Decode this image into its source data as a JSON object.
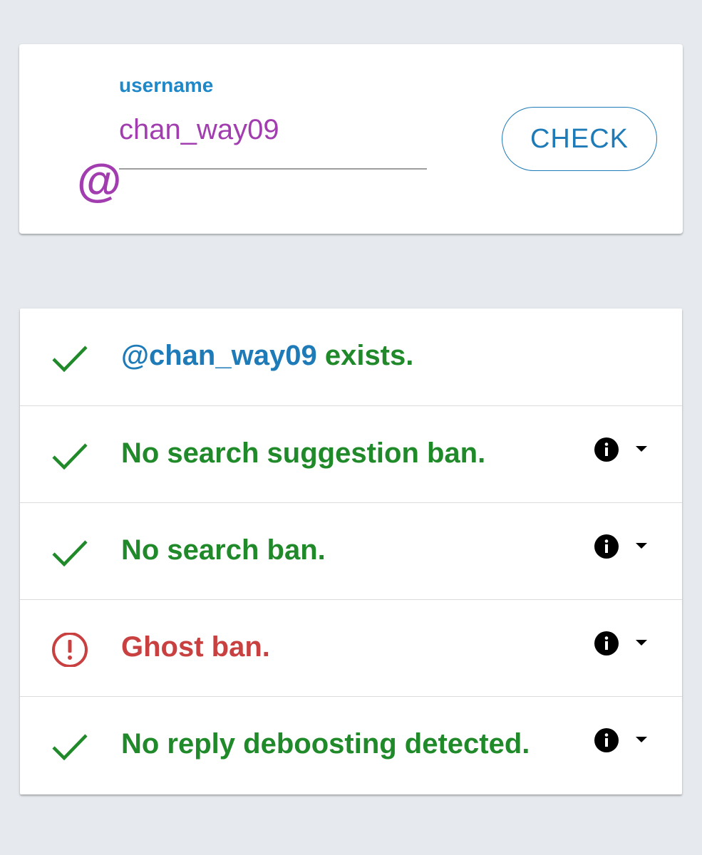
{
  "input_card": {
    "at_symbol": "@",
    "label": "username",
    "value": "chan_way09",
    "check_label": "CHECK"
  },
  "results": [
    {
      "status": "ok",
      "icon": "checkmark-icon",
      "handle": "@chan_way09",
      "text": " exists.",
      "has_info": false
    },
    {
      "status": "ok",
      "icon": "checkmark-icon",
      "text": "No search suggestion ban.",
      "has_info": true
    },
    {
      "status": "ok",
      "icon": "checkmark-icon",
      "text": "No search ban.",
      "has_info": true
    },
    {
      "status": "bad",
      "icon": "alert-circle-icon",
      "text": "Ghost ban.",
      "has_info": true
    },
    {
      "status": "ok",
      "icon": "checkmark-icon",
      "text": "No reply deboosting detected.",
      "has_info": true
    }
  ],
  "colors": {
    "background": "#e6eaee",
    "accent_blue": "#1e88c8",
    "username_purple": "#a23db0",
    "ok_green": "#208a2a",
    "error_red": "#c84040"
  }
}
